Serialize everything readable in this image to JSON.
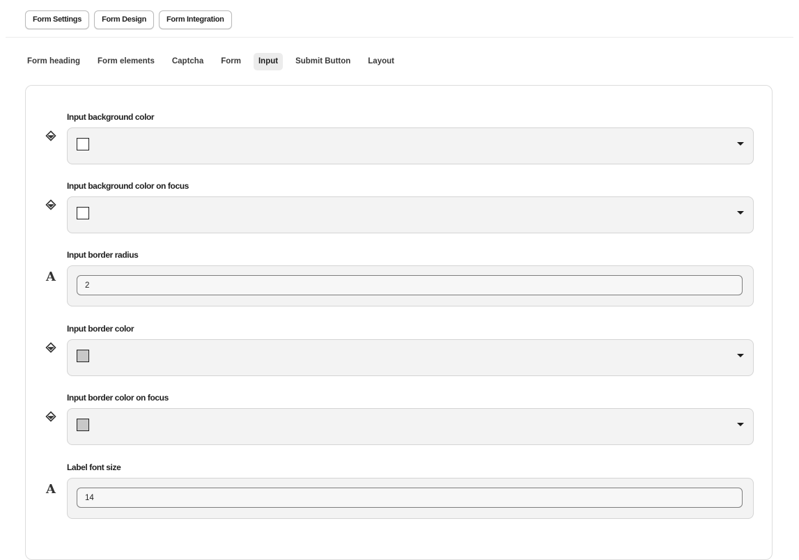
{
  "top_tabs": [
    "Form Settings",
    "Form Design",
    "Form Integration"
  ],
  "sub_tabs": [
    "Form heading",
    "Form elements",
    "Captcha",
    "Form",
    "Input",
    "Submit Button",
    "Layout"
  ],
  "active_sub_tab": "Input",
  "fields": {
    "input_bg": {
      "label": "Input background color",
      "icon": "paint-bucket-icon",
      "swatch": "#ffffff"
    },
    "input_bg_focus": {
      "label": "Input background color on focus",
      "icon": "paint-bucket-icon",
      "swatch": "#ffffff"
    },
    "input_radius": {
      "label": "Input border radius",
      "icon": "font-size-icon",
      "icon_glyph": "A",
      "value": "2"
    },
    "input_border": {
      "label": "Input border color",
      "icon": "paint-bucket-icon",
      "swatch": "#c8c8c8"
    },
    "input_border_focus": {
      "label": "Input border color on focus",
      "icon": "paint-bucket-icon",
      "swatch": "#c8c8c8"
    },
    "label_font_size": {
      "label": "Label font size",
      "icon": "font-size-icon",
      "icon_glyph": "A",
      "value": "14"
    }
  }
}
